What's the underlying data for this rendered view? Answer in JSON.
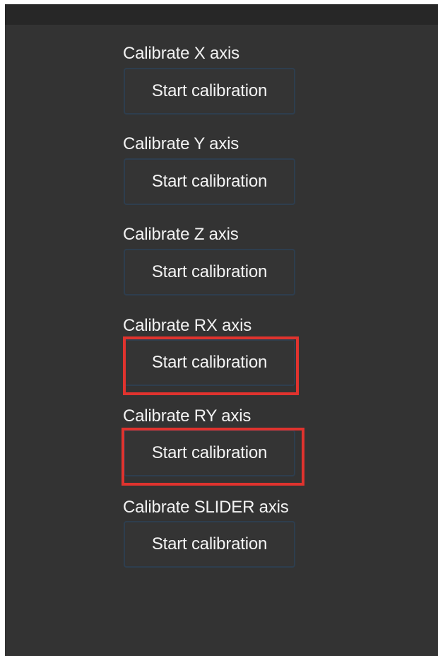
{
  "axes": [
    {
      "label": "Calibrate X axis",
      "button_label": "Start calibration"
    },
    {
      "label": "Calibrate Y axis",
      "button_label": "Start calibration"
    },
    {
      "label": "Calibrate Z axis",
      "button_label": "Start calibration"
    },
    {
      "label": "Calibrate RX axis",
      "button_label": "Start calibration"
    },
    {
      "label": "Calibrate RY axis",
      "button_label": "Start calibration"
    },
    {
      "label": "Calibrate SLIDER axis",
      "button_label": "Start calibration"
    }
  ],
  "colors": {
    "background": "#333333",
    "top_bar": "#272727",
    "text": "#f2f2f2",
    "button_border": "#2e3e4e",
    "highlight": "#e0332e"
  }
}
